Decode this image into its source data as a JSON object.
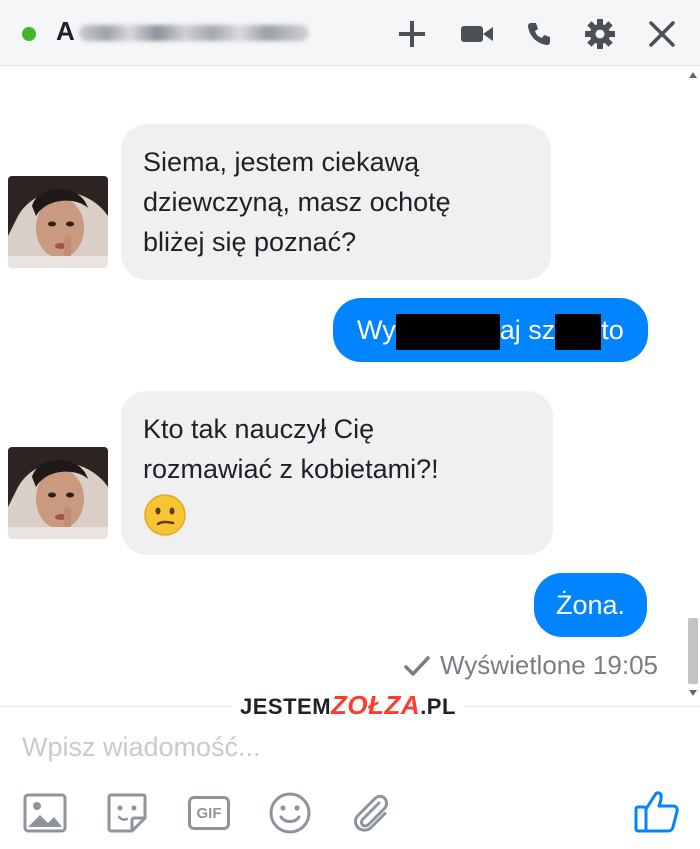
{
  "header": {
    "contact_initial": "A",
    "status": "online",
    "icons": [
      "add-icon",
      "video-camera-icon",
      "phone-icon",
      "gear-icon",
      "close-icon"
    ]
  },
  "conversation": {
    "messages": [
      {
        "from": "them",
        "text_lines": [
          "Siema, jestem ciekawą",
          "dziewczyną, masz ochotę",
          "bliżej się poznać?"
        ]
      },
      {
        "from": "me",
        "parts": [
          "Wy",
          "aj sz",
          "to"
        ]
      },
      {
        "from": "them",
        "text_lines": [
          "Kto tak nauczył Cię",
          "rozmawiać z kobietami?!"
        ],
        "emoji": "confused-face"
      },
      {
        "from": "me",
        "text": "Żona."
      }
    ],
    "seen_label": "Wyświetlone 19:05"
  },
  "watermark": {
    "part1": "JESTEM",
    "part2": "ZOŁZA",
    "part3": ".PL"
  },
  "composer": {
    "placeholder": "Wpisz wiadomość..."
  },
  "toolbar": {
    "gif_label": "GIF",
    "icons": [
      "image-icon",
      "sticker-icon",
      "gif-icon",
      "emoji-icon",
      "attachment-icon",
      "thumbs-up-icon"
    ]
  },
  "colors": {
    "accent": "#0084ff",
    "incoming_bubble": "#f1f0f0",
    "online": "#42b72a",
    "icon_gray": "#4b4f56"
  }
}
